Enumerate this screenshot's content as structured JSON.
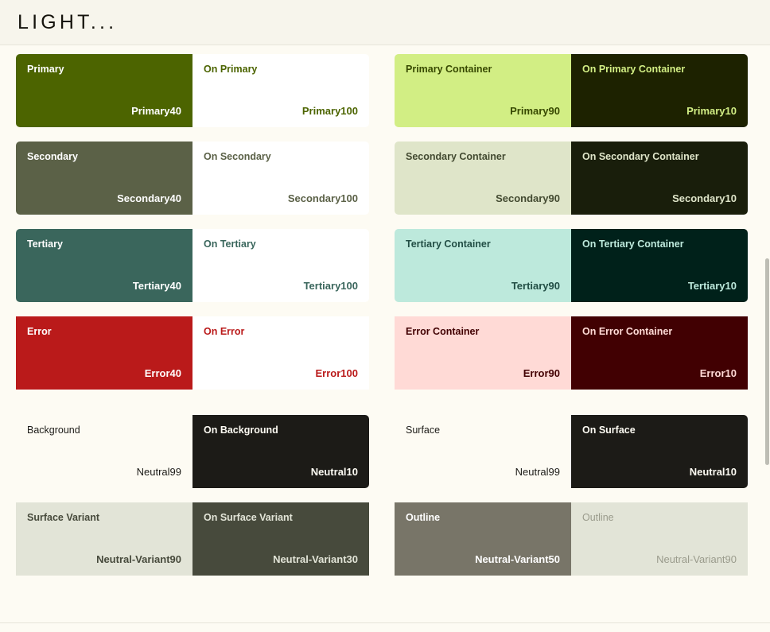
{
  "header": {
    "title": "LIGHT..."
  },
  "theme": {
    "page_background": "#FDFBF3",
    "header_background": "#F7F5EC",
    "divider": "#E6E4DA",
    "scrollbar_thumb": "#BDBDB4"
  },
  "palette": {
    "core_rows": [
      {
        "name": "primary",
        "rounded": true,
        "left": {
          "role": "Primary",
          "tone": "Primary40",
          "bg": "#4C6400",
          "fg": "#FFFFFF"
        },
        "right": {
          "role": "On Primary",
          "tone": "Primary100",
          "bg": "#FFFFFF",
          "fg": "#4C6400"
        }
      },
      {
        "name": "primary-container",
        "rounded": true,
        "left": {
          "role": "Primary Container",
          "tone": "Primary90",
          "bg": "#D2EE84",
          "fg": "#374900"
        },
        "right": {
          "role": "On Primary Container",
          "tone": "Primary10",
          "bg": "#1D2200",
          "fg": "#D2EE84"
        }
      },
      {
        "name": "secondary",
        "rounded": true,
        "left": {
          "role": "Secondary",
          "tone": "Secondary40",
          "bg": "#5B6147",
          "fg": "#FFFFFF"
        },
        "right": {
          "role": "On Secondary",
          "tone": "Secondary100",
          "bg": "#FFFFFF",
          "fg": "#5B6147"
        }
      },
      {
        "name": "secondary-container",
        "rounded": true,
        "left": {
          "role": "Secondary Container",
          "tone": "Secondary90",
          "bg": "#DFE5C9",
          "fg": "#434A31"
        },
        "right": {
          "role": "On Secondary Container",
          "tone": "Secondary10",
          "bg": "#191E0B",
          "fg": "#DFE5C9"
        }
      },
      {
        "name": "tertiary",
        "rounded": true,
        "left": {
          "role": "Tertiary",
          "tone": "Tertiary40",
          "bg": "#3A665C",
          "fg": "#FFFFFF"
        },
        "right": {
          "role": "On Tertiary",
          "tone": "Tertiary100",
          "bg": "#FFFFFF",
          "fg": "#3A665C"
        }
      },
      {
        "name": "tertiary-container",
        "rounded": true,
        "left": {
          "role": "Tertiary Container",
          "tone": "Tertiary90",
          "bg": "#BDE9DC",
          "fg": "#224E45"
        },
        "right": {
          "role": "On Tertiary Container",
          "tone": "Tertiary10",
          "bg": "#00211A",
          "fg": "#BDE9DC"
        }
      },
      {
        "name": "error",
        "rounded": false,
        "left": {
          "role": "Error",
          "tone": "Error40",
          "bg": "#BA1A1A",
          "fg": "#FFFFFF"
        },
        "right": {
          "role": "On Error",
          "tone": "Error100",
          "bg": "#FFFFFF",
          "fg": "#BA1A1A"
        }
      },
      {
        "name": "error-container",
        "rounded": false,
        "left": {
          "role": "Error Container",
          "tone": "Error90",
          "bg": "#FFDAD6",
          "fg": "#410002"
        },
        "right": {
          "role": "On Error Container",
          "tone": "Error10",
          "bg": "#410002",
          "fg": "#FFDAD6"
        }
      }
    ],
    "neutral_rows": [
      {
        "name": "background",
        "rounded": true,
        "left": {
          "role": "Background",
          "tone": "Neutral99",
          "bg": "#FDFBF3",
          "fg": "#1C1B17",
          "plain": true
        },
        "right": {
          "role": "On Background",
          "tone": "Neutral10",
          "bg": "#1C1B17",
          "fg": "#FDFBF3"
        }
      },
      {
        "name": "surface",
        "rounded": true,
        "left": {
          "role": "Surface",
          "tone": "Neutral99",
          "bg": "#FDFBF3",
          "fg": "#1C1B17",
          "plain": true
        },
        "right": {
          "role": "On Surface",
          "tone": "Neutral10",
          "bg": "#1C1B17",
          "fg": "#FDFBF3"
        }
      },
      {
        "name": "surface-variant",
        "rounded": false,
        "left": {
          "role": "Surface Variant",
          "tone": "Neutral-Variant90",
          "bg": "#E2E4D7",
          "fg": "#474A3C"
        },
        "right": {
          "role": "On Surface Variant",
          "tone": "Neutral-Variant30",
          "bg": "#474A3C",
          "fg": "#E2E4D7"
        }
      },
      {
        "name": "outline",
        "rounded": false,
        "left": {
          "role": "Outline",
          "tone": "Neutral-Variant50",
          "bg": "#787568",
          "fg": "#FFFFFF"
        },
        "right": {
          "role": "Outline",
          "tone": "Neutral-Variant90",
          "bg": "#E2E4D7",
          "fg": "#9A9B8C",
          "plain": true
        }
      }
    ]
  }
}
